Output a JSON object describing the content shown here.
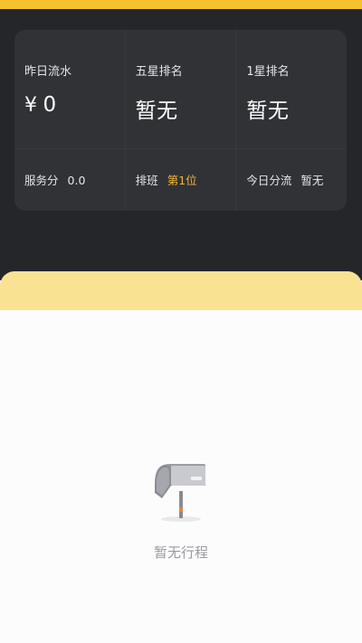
{
  "stats": {
    "yesterday_flow": {
      "label": "昨日流水",
      "currency": "¥",
      "value": "0"
    },
    "five_star_rank": {
      "label": "五星排名",
      "value": "暂无"
    },
    "one_star_rank": {
      "label": "1星排名",
      "value": "暂无"
    },
    "service_score": {
      "label": "服务分",
      "value": "0.0"
    },
    "schedule": {
      "label": "排班",
      "value": "第1位"
    },
    "today_diversion": {
      "label": "今日分流",
      "value": "暂无"
    }
  },
  "colors": {
    "accent_yellow": "#f5c22d",
    "highlight": "#f2b634",
    "dark_bg": "#25262a",
    "card_bg": "#313236"
  },
  "empty_state": {
    "icon": "mailbox-icon",
    "text": "暂无行程"
  }
}
